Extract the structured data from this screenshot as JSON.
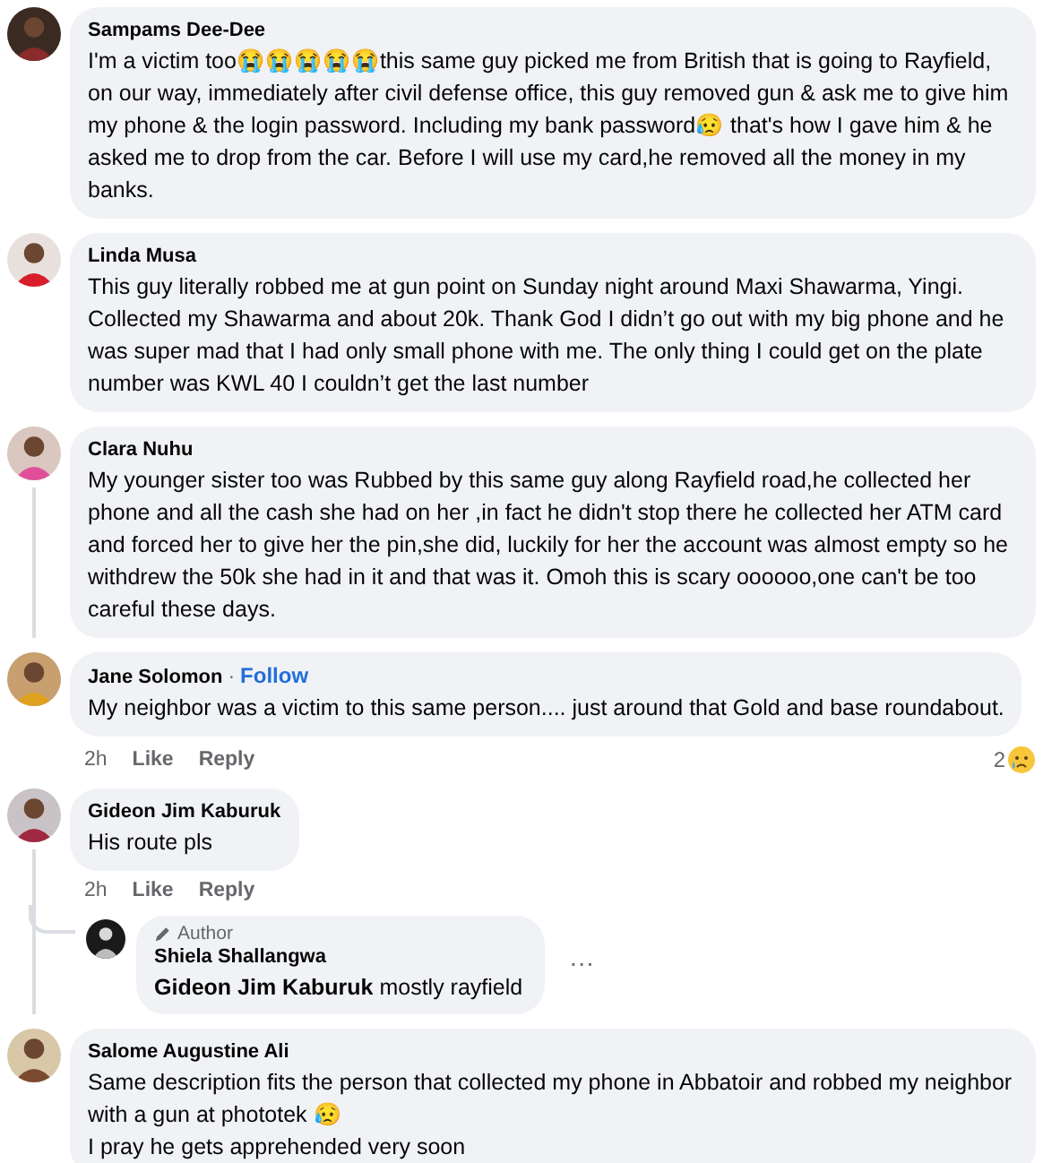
{
  "comments": [
    {
      "author": "Sampams Dee-Dee",
      "text": "I'm a victim too😭😭😭😭😭this same guy picked me from British that is going to Rayfield, on our way, immediately after civil defense office, this guy removed gun & ask me to give him my phone & the login password. Including my bank password😥 that's how I gave him & he asked me to drop from the car. Before I will use my card,he removed all the money in my banks.",
      "has_replies": false
    },
    {
      "author": "Linda Musa",
      "text": "This guy literally robbed me at gun point on Sunday night around Maxi Shawarma, Yingi. Collected my Shawarma and about 20k. Thank God I didn’t go out with my big phone and he was super mad that I had only small phone with me. The only thing I could get on the plate number was KWL 40 I couldn’t get the last number",
      "has_replies": false
    },
    {
      "author": "Clara Nuhu",
      "text": "My younger sister too was Rubbed by this same guy along Rayfield road,he collected her phone and all the cash she had on her ,in fact he didn't stop there he collected her ATM card and forced her to give her the pin,she did, luckily for her the account was almost empty so he withdrew the 50k she had in it and that was it. Omoh this is scary oooooo,one can't be too careful these days.",
      "has_replies": true
    },
    {
      "author": "Jane Solomon",
      "separator": "·",
      "follow": "Follow",
      "text": "My neighbor was a victim to this same person.... just around that Gold and base roundabout.",
      "time": "2h",
      "like": "Like",
      "reply": "Reply",
      "reaction_count": "2",
      "has_replies": false
    },
    {
      "author": "Gideon Jim Kaburuk",
      "text": "His route pls",
      "time": "2h",
      "like": "Like",
      "reply": "Reply",
      "has_replies": true,
      "replies": [
        {
          "author": "Shiela Shallangwa",
          "badge": "Author",
          "text": "**Gideon Jim Kaburuk** mostly rayfield",
          "more": "···"
        }
      ]
    },
    {
      "author": "Salome Augustine Ali",
      "text": "Same description fits the person that collected my phone in Abbatoir and robbed my neighbor with a gun at phototek 😥\nI pray he gets apprehended very soon",
      "has_replies": false
    }
  ]
}
